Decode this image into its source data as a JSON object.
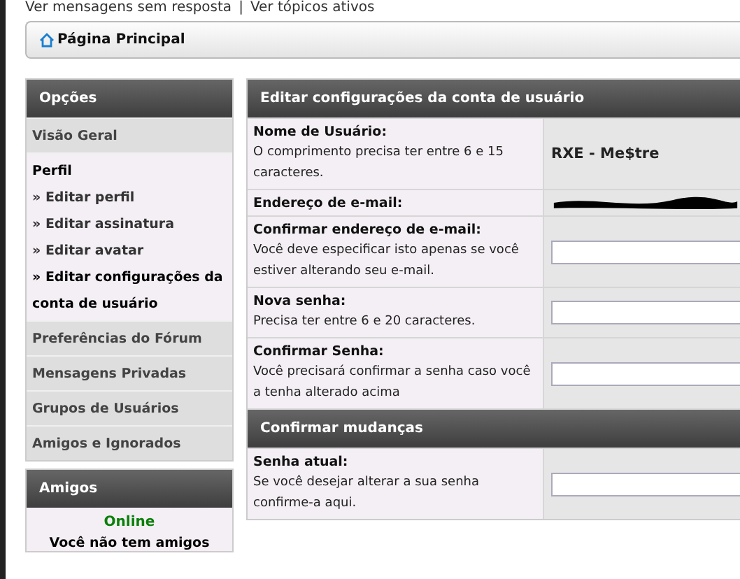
{
  "top_links": [
    "Ver mensagens sem resposta",
    "Ver tópicos ativos"
  ],
  "top_separator": "|",
  "breadcrumb": {
    "label": "Página Principal"
  },
  "sidebar": {
    "title": "Opções",
    "items": [
      {
        "label": "Visão Geral",
        "selected": false
      },
      {
        "label": "Perfil",
        "selected": true,
        "children": [
          {
            "label": "» Editar perfil",
            "selected": false
          },
          {
            "label": "» Editar assinatura",
            "selected": false
          },
          {
            "label": "» Editar avatar",
            "selected": false
          },
          {
            "label": "» Editar configurações da conta de usuário",
            "selected": true
          }
        ]
      },
      {
        "label": "Preferências do Fórum",
        "selected": false
      },
      {
        "label": "Mensagens Privadas",
        "selected": false
      },
      {
        "label": "Grupos de Usuários",
        "selected": false
      },
      {
        "label": "Amigos e Ignorados",
        "selected": false
      }
    ]
  },
  "friends": {
    "title": "Amigos",
    "status": "Online",
    "message": "Você não tem amigos"
  },
  "sections": [
    {
      "title": "Editar configurações da conta de usuário",
      "rows": [
        {
          "kind": "text",
          "label": "Nome de Usuário:",
          "hint": "O comprimento precisa ter entre 6 e 15 caracteres.",
          "value": "RXE - Me$tre"
        },
        {
          "kind": "redacted",
          "label": "Endereço de e-mail:"
        },
        {
          "kind": "input",
          "label": "Confirmar endereço de e-mail:",
          "hint": "Você deve especificar isto apenas se você estiver alterando seu e-mail."
        },
        {
          "kind": "input",
          "label": "Nova senha:",
          "hint": "Precisa ter entre 6 e 20 caracteres."
        },
        {
          "kind": "input",
          "label": "Confirmar Senha:",
          "hint": "Você precisará confirmar a senha caso você a tenha alterado acima"
        }
      ]
    },
    {
      "title": "Confirmar mudanças",
      "rows": [
        {
          "kind": "input",
          "label": "Senha atual:",
          "hint": "Se você desejar alterar a sua senha confirme-a aqui."
        }
      ]
    }
  ]
}
